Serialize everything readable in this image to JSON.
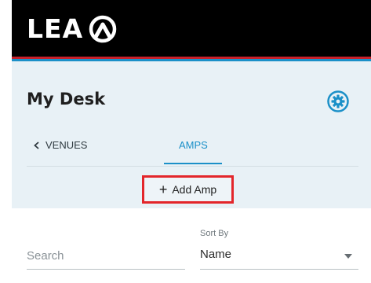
{
  "header": {
    "logo_text": "LEA"
  },
  "page": {
    "title": "My Desk"
  },
  "tabs": {
    "back_label": "VENUES",
    "active_label": "AMPS"
  },
  "actions": {
    "add_label": "Add Amp"
  },
  "filters": {
    "search_placeholder": "Search",
    "search_value": "",
    "sort_label": "Sort By",
    "sort_value": "Name"
  },
  "colors": {
    "header_bg": "#000000",
    "accent_red": "#c8202a",
    "accent_blue": "#1b90c8",
    "panel_bg": "#e8f1f6",
    "highlight_border": "#e3262b"
  },
  "icons": {
    "logo_mark": "lea-logo-icon",
    "settings": "gear-icon",
    "back": "chevron-left-icon",
    "add": "plus-icon",
    "dropdown": "dropdown-arrow-icon"
  }
}
